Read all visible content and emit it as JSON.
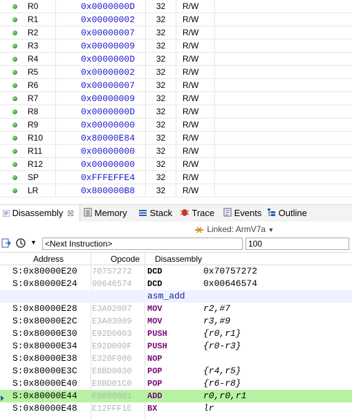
{
  "registers": [
    {
      "name": "R0",
      "value": "0x0000000D",
      "bits": "32",
      "access": "R/W"
    },
    {
      "name": "R1",
      "value": "0x00000002",
      "bits": "32",
      "access": "R/W"
    },
    {
      "name": "R2",
      "value": "0x00000007",
      "bits": "32",
      "access": "R/W"
    },
    {
      "name": "R3",
      "value": "0x00000009",
      "bits": "32",
      "access": "R/W"
    },
    {
      "name": "R4",
      "value": "0x0000000D",
      "bits": "32",
      "access": "R/W"
    },
    {
      "name": "R5",
      "value": "0x00000002",
      "bits": "32",
      "access": "R/W"
    },
    {
      "name": "R6",
      "value": "0x00000007",
      "bits": "32",
      "access": "R/W"
    },
    {
      "name": "R7",
      "value": "0x00000009",
      "bits": "32",
      "access": "R/W"
    },
    {
      "name": "R8",
      "value": "0x0000000D",
      "bits": "32",
      "access": "R/W"
    },
    {
      "name": "R9",
      "value": "0x00000000",
      "bits": "32",
      "access": "R/W"
    },
    {
      "name": "R10",
      "value": "0x80000E84",
      "bits": "32",
      "access": "R/W"
    },
    {
      "name": "R11",
      "value": "0x00000000",
      "bits": "32",
      "access": "R/W"
    },
    {
      "name": "R12",
      "value": "0x00000000",
      "bits": "32",
      "access": "R/W"
    },
    {
      "name": "SP",
      "value": "0xFFFEFFE4",
      "bits": "32",
      "access": "R/W"
    },
    {
      "name": "LR",
      "value": "0x800000B8",
      "bits": "32",
      "access": "R/W"
    }
  ],
  "tabs": {
    "disassembly": "Disassembly",
    "disassembly_close": "☒",
    "memory": "Memory",
    "stack": "Stack",
    "trace": "Trace",
    "events": "Events",
    "outline": "Outline"
  },
  "linked": {
    "label": "Linked: ArmV7a"
  },
  "toolbar": {
    "address": "<Next Instruction>",
    "lines": "100"
  },
  "columns": {
    "address": "Address",
    "opcode": "Opcode",
    "disassembly": "Disassembly"
  },
  "rows": [
    {
      "address": "S:0x80000E20",
      "opcode": "70757272",
      "mnemonic": "DCD",
      "args": "0x70757272"
    },
    {
      "address": "S:0x80000E24",
      "opcode": "00646574",
      "mnemonic": "DCD",
      "args": "0x00646574"
    },
    {
      "label": "asm_add"
    },
    {
      "address": "S:0x80000E28",
      "opcode": "E3A02007",
      "mnemonic": "MOV",
      "args": "r2,#7"
    },
    {
      "address": "S:0x80000E2C",
      "opcode": "E3A03009",
      "mnemonic": "MOV",
      "args": "r3,#9"
    },
    {
      "address": "S:0x80000E30",
      "opcode": "E92D0003",
      "mnemonic": "PUSH",
      "args": "{r0,r1}"
    },
    {
      "address": "S:0x80000E34",
      "opcode": "E92D000F",
      "mnemonic": "PUSH",
      "args": "{r0-r3}"
    },
    {
      "address": "S:0x80000E38",
      "opcode": "E320F000",
      "mnemonic": "NOP",
      "args": ""
    },
    {
      "address": "S:0x80000E3C",
      "opcode": "E8BD0030",
      "mnemonic": "POP",
      "args": "{r4,r5}"
    },
    {
      "address": "S:0x80000E40",
      "opcode": "E8BD01C0",
      "mnemonic": "POP",
      "args": "{r6-r8}"
    },
    {
      "address": "S:0x80000E44",
      "opcode": "E0800001",
      "mnemonic": "ADD",
      "args": "r0,r0,r1"
    },
    {
      "address": "S:0x80000E48",
      "opcode": "E12FFF1E",
      "mnemonic": "BX",
      "args": "lr"
    }
  ],
  "colors": {
    "accent_highlight": "#b6f2a2",
    "value_blue": "#1a1ad0",
    "mnemonic_purple": "#7a0a7a"
  }
}
